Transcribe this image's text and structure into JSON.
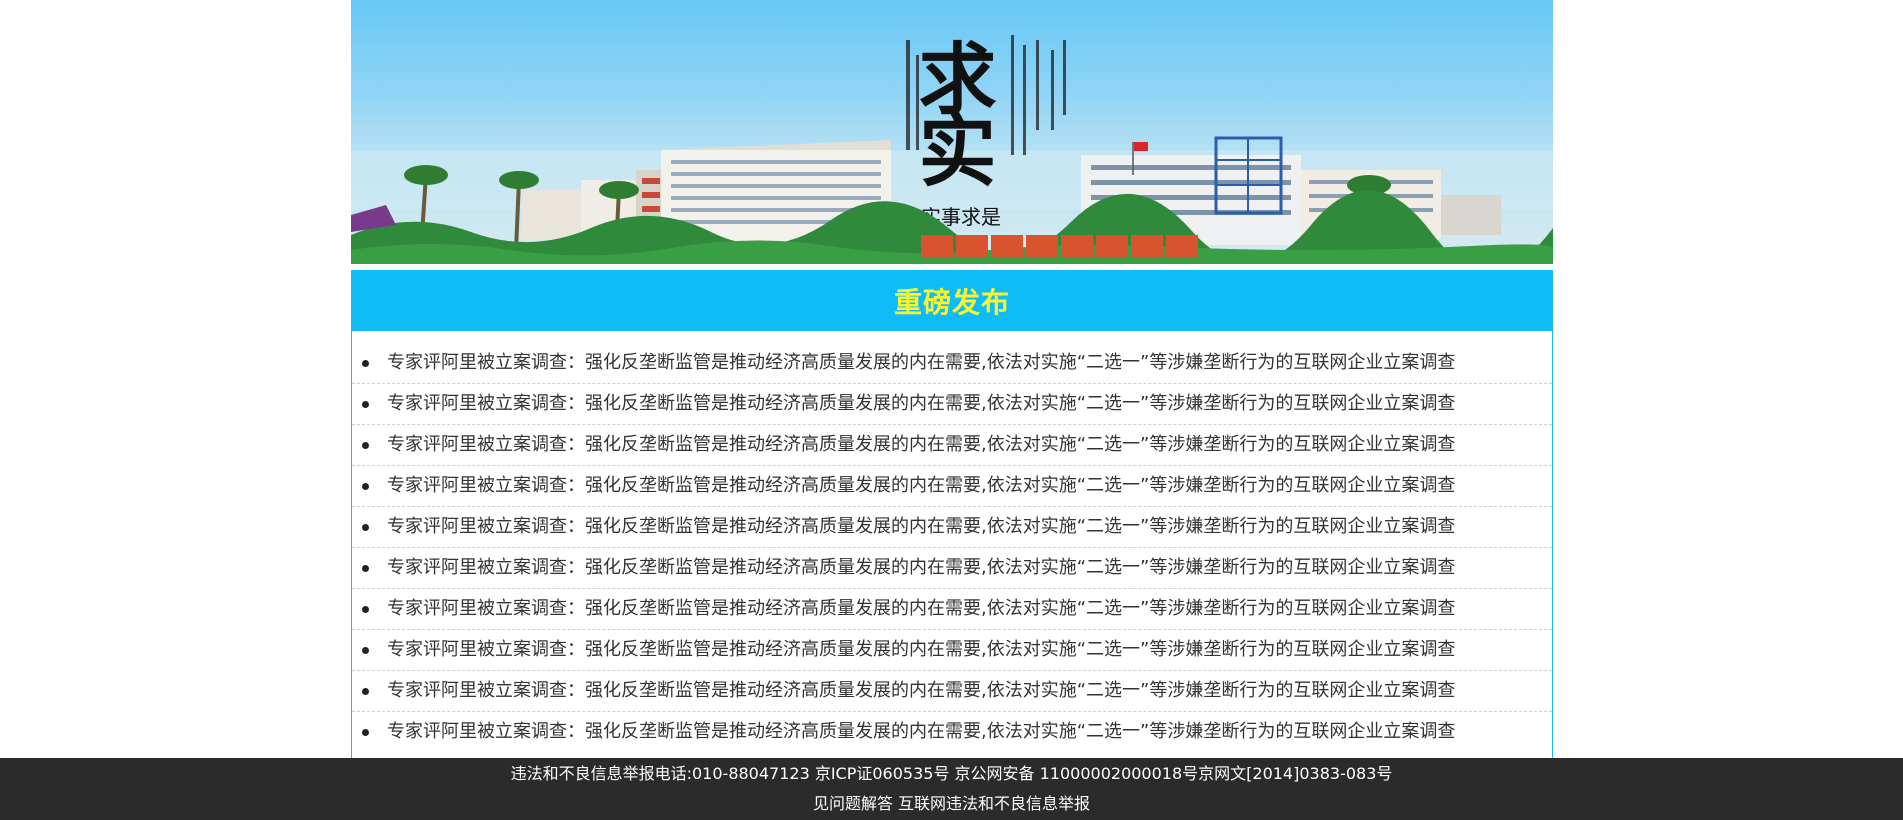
{
  "banner": {
    "big_text": "求实",
    "small_text": "实事求是",
    "colors": {
      "sky": "#67c7f4",
      "building": "#f2f2f0",
      "tree": "#2e8b3a"
    }
  },
  "section": {
    "title": "重磅发布",
    "colors": {
      "header_bg": "#0fbcf7",
      "title": "#f9f531",
      "border": "#19b9ef"
    },
    "items": [
      {
        "text": "专家评阿里被立案调查：强化反垄断监管是推动经济高质量发展的内在需要,依法对实施“二选一”等涉嫌垄断行为的互联网企业立案调查"
      },
      {
        "text": "专家评阿里被立案调查：强化反垄断监管是推动经济高质量发展的内在需要,依法对实施“二选一”等涉嫌垄断行为的互联网企业立案调查"
      },
      {
        "text": "专家评阿里被立案调查：强化反垄断监管是推动经济高质量发展的内在需要,依法对实施“二选一”等涉嫌垄断行为的互联网企业立案调查"
      },
      {
        "text": "专家评阿里被立案调查：强化反垄断监管是推动经济高质量发展的内在需要,依法对实施“二选一”等涉嫌垄断行为的互联网企业立案调查"
      },
      {
        "text": "专家评阿里被立案调查：强化反垄断监管是推动经济高质量发展的内在需要,依法对实施“二选一”等涉嫌垄断行为的互联网企业立案调查"
      },
      {
        "text": "专家评阿里被立案调查：强化反垄断监管是推动经济高质量发展的内在需要,依法对实施“二选一”等涉嫌垄断行为的互联网企业立案调查"
      },
      {
        "text": "专家评阿里被立案调查：强化反垄断监管是推动经济高质量发展的内在需要,依法对实施“二选一”等涉嫌垄断行为的互联网企业立案调查"
      },
      {
        "text": "专家评阿里被立案调查：强化反垄断监管是推动经济高质量发展的内在需要,依法对实施“二选一”等涉嫌垄断行为的互联网企业立案调查"
      },
      {
        "text": "专家评阿里被立案调查：强化反垄断监管是推动经济高质量发展的内在需要,依法对实施“二选一”等涉嫌垄断行为的互联网企业立案调查"
      },
      {
        "text": "专家评阿里被立案调查：强化反垄断监管是推动经济高质量发展的内在需要,依法对实施“二选一”等涉嫌垄断行为的互联网企业立案调查"
      }
    ]
  },
  "footer": {
    "line1": "违法和不良信息举报电话:010-88047123 京ICP证060535号 京公网安备 11000002000018号京网文[2014]0383-083号",
    "link_faq": "见问题解答",
    "link_report": "互联网违法和不良信息举报",
    "colors": {
      "bg": "#2b2b2b",
      "text": "#ffffff"
    }
  }
}
